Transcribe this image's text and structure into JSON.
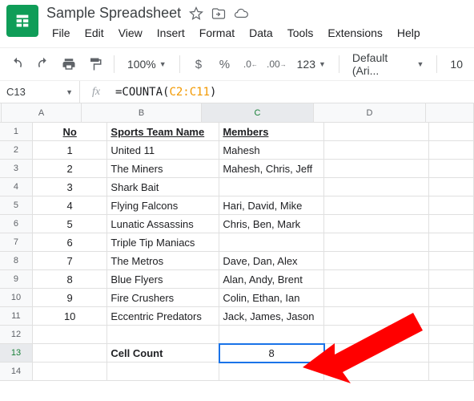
{
  "doc_title": "Sample Spreadsheet",
  "menubar": [
    "File",
    "Edit",
    "View",
    "Insert",
    "Format",
    "Data",
    "Tools",
    "Extensions",
    "Help"
  ],
  "toolbar": {
    "zoom": "100%",
    "decimals": "123",
    "font": "Default (Ari...",
    "font_size": "10"
  },
  "formula_bar": {
    "cell_ref": "C13",
    "formula_prefix": "=COUNTA",
    "formula_open": "(",
    "formula_range": "C2:C11",
    "formula_close": ")"
  },
  "columns": [
    "A",
    "B",
    "C",
    "D"
  ],
  "col_e_partial": "",
  "headers": {
    "no": "No",
    "team": "Sports Team Name",
    "members": "Members"
  },
  "rows": [
    {
      "n": "1",
      "team": "United 11",
      "members": "Mahesh"
    },
    {
      "n": "2",
      "team": "The Miners",
      "members": "Mahesh, Chris, Jeff"
    },
    {
      "n": "3",
      "team": "Shark Bait",
      "members": ""
    },
    {
      "n": "4",
      "team": "Flying Falcons",
      "members": "Hari, David, Mike"
    },
    {
      "n": "5",
      "team": "Lunatic Assassins",
      "members": "Chris, Ben, Mark"
    },
    {
      "n": "6",
      "team": "Triple Tip Maniacs",
      "members": ""
    },
    {
      "n": "7",
      "team": "The Metros",
      "members": "Dave, Dan, Alex"
    },
    {
      "n": "8",
      "team": "Blue Flyers",
      "members": "Alan, Andy, Brent"
    },
    {
      "n": "9",
      "team": "Fire Crushers",
      "members": "Colin, Ethan, Ian"
    },
    {
      "n": "10",
      "team": "Eccentric Predators",
      "members": "Jack, James, Jason"
    }
  ],
  "row_numbers": [
    "1",
    "2",
    "3",
    "4",
    "5",
    "6",
    "7",
    "8",
    "9",
    "10",
    "11",
    "12",
    "13",
    "14"
  ],
  "cell_count_label": "Cell Count",
  "cell_count_value": "8"
}
